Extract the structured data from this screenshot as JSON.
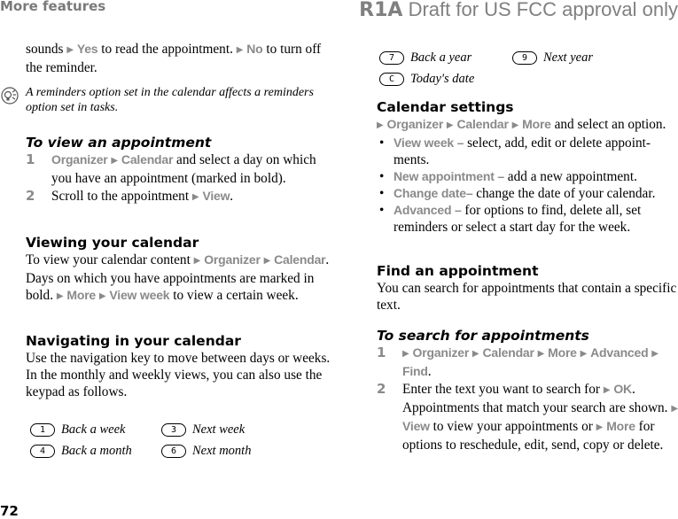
{
  "header": {
    "section": "More features",
    "draft_code": "R1A",
    "draft_text": "Draft for US FCC approval only"
  },
  "page_number": "72",
  "left": {
    "intro": {
      "p1": "sounds ",
      "k1": "Yes",
      "p2": " to read the appointment. ",
      "k2": "No",
      "p3": " to turn off the reminder."
    },
    "tip": {
      "icon": "lightbulb-tip-icon",
      "text": "A reminders option set in the calendar affects a reminders option set in tasks."
    },
    "view_appointment": {
      "title": "To view an appointment",
      "steps": [
        {
          "num": "1",
          "k1": "Organizer",
          "k2": "Calendar",
          "text": " and select a day on which you have an appointment (marked in bold)."
        },
        {
          "num": "2",
          "text": "Scroll to the appointment ",
          "k1": "View",
          "end": "."
        }
      ]
    },
    "viewing": {
      "title": "Viewing your calendar",
      "p1": "To view your calendar content ",
      "k1": "Organizer",
      "k2": "Calendar",
      "p2": ". Days on which you have appointments are marked in bold. ",
      "k3": "More",
      "k4": "View week",
      "p3": " to view a certain week."
    },
    "navigating": {
      "title": "Navigating in your calendar",
      "body": "Use the navigation key to move between days or weeks. In the monthly and weekly views, you can also use the keypad as follows."
    },
    "keys": [
      [
        {
          "key": "1",
          "label": "Back a week"
        },
        {
          "key": "3",
          "label": "Next week"
        }
      ],
      [
        {
          "key": "4",
          "label": "Back a month"
        },
        {
          "key": "6",
          "label": "Next month"
        }
      ]
    ]
  },
  "right": {
    "keys": [
      [
        {
          "key": "7",
          "label": "Back a year"
        },
        {
          "key": "9",
          "label": "Next year"
        }
      ],
      [
        {
          "key": "C",
          "label": "Today's date"
        }
      ]
    ],
    "settings": {
      "title": "Calendar settings",
      "k1": "Organizer",
      "k2": "Calendar",
      "k3": "More",
      "p1": " and select an option.",
      "bullets": [
        {
          "key": "View week –",
          "text": " select, add, edit or delete appoint-ments."
        },
        {
          "key": "New appointment –",
          "text": " add a new appointment."
        },
        {
          "key": "Change date–",
          "text": " change the date of your calendar."
        },
        {
          "key": "Advanced –",
          "text": " for options to find, delete all, set reminders or select a start day for the week."
        }
      ]
    },
    "find": {
      "title": "Find an appointment",
      "body": "You can search for appointments that contain a specific text."
    },
    "search": {
      "title": "To search for appointments",
      "step1": {
        "num": "1",
        "k1": "Organizer",
        "k2": "Calendar",
        "k3": "More",
        "k4": "Advanced",
        "k5": "Find",
        "end": "."
      },
      "step2": {
        "num": "2",
        "p1": "Enter the text you want to search for ",
        "k1": "OK",
        "p2": ". Appointments that match your search are shown. ",
        "k2": "View",
        "p3": " to view your appointments or ",
        "k3": "More",
        "p4": " for options to reschedule, edit, send, copy or delete."
      }
    }
  },
  "colors": {
    "keyword_gray": "#8a8a8a",
    "header_gray": "#7a7a7a"
  }
}
